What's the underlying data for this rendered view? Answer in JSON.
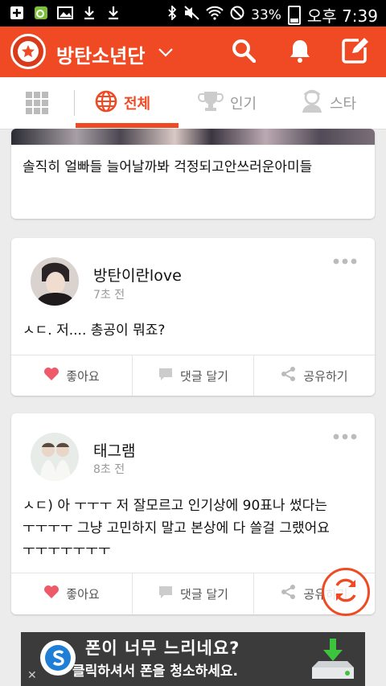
{
  "status_bar": {
    "battery": "33%",
    "time": "오후 7:39"
  },
  "app_bar": {
    "title": "방탄소년단",
    "icons": [
      "star-badge-icon",
      "chevron-down-icon",
      "search-icon",
      "bell-icon",
      "compose-icon"
    ],
    "accent": "#ef4a24"
  },
  "tabs": [
    {
      "label": "전체",
      "icon": "globe-icon",
      "active": true
    },
    {
      "label": "인기",
      "icon": "trophy-icon",
      "active": false
    },
    {
      "label": "스타",
      "icon": "star-person-icon",
      "active": false
    }
  ],
  "posts": [
    {
      "text": "솔직히 얼빠들 늘어날까봐 걱정되고안쓰러운아미들"
    },
    {
      "username": "방탄이란love",
      "time": "7초 전",
      "text": "ㅅㄷ. 저....  총공이 뭐죠?"
    },
    {
      "username": "태그램",
      "time": "8초 전",
      "text_lines": [
        "ㅅㄷ) 아 ㅜㅜㅜ 저 잘모르고 인기상에 90표나 썼다는",
        "ㅜㅜㅜㅜ 그냥 고민하지 말고 본상에 다 쓸걸 그랬어요",
        "ㅜㅜㅜㅜㅜㅜㅜ"
      ]
    }
  ],
  "actions": {
    "like": "좋아요",
    "comment": "댓글 달기",
    "share": "공유하기"
  },
  "ad": {
    "line1": "폰이 너무 느리네요?",
    "line2": "클릭하셔서 폰을 청소하세요.",
    "close": "✕"
  }
}
